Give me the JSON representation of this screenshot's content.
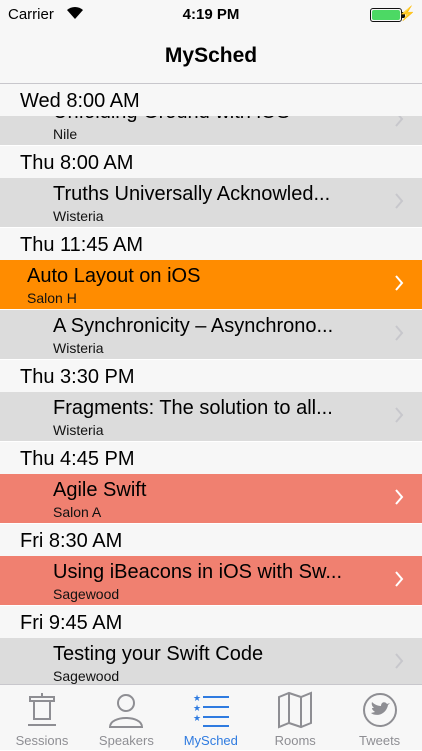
{
  "status_bar": {
    "carrier": "Carrier",
    "time": "4:19 PM"
  },
  "nav": {
    "title": "MySched"
  },
  "sections": [
    {
      "header": "Wed 8:00 AM",
      "rows": [
        {
          "title": "Unfolding Ground with iOS",
          "room": "Nile",
          "color": "gray",
          "indent": 1
        }
      ]
    },
    {
      "header": "Thu 8:00 AM",
      "rows": [
        {
          "title": "Truths Universally Acknowled...",
          "room": "Wisteria",
          "color": "gray",
          "indent": 1
        }
      ]
    },
    {
      "header": "Thu 11:45 AM",
      "rows": [
        {
          "title": "Auto Layout on iOS",
          "room": "Salon H",
          "color": "orange",
          "indent": 0
        },
        {
          "title": "A Synchronicity – Asynchrono...",
          "room": "Wisteria",
          "color": "gray",
          "indent": 1
        }
      ]
    },
    {
      "header": "Thu 3:30 PM",
      "rows": [
        {
          "title": "Fragments: The solution to all...",
          "room": "Wisteria",
          "color": "gray",
          "indent": 1
        }
      ]
    },
    {
      "header": "Thu 4:45 PM",
      "rows": [
        {
          "title": "Agile Swift",
          "room": "Salon A",
          "color": "salmon",
          "indent": 1
        }
      ]
    },
    {
      "header": "Fri 8:30 AM",
      "rows": [
        {
          "title": "Using iBeacons in iOS with Sw...",
          "room": "Sagewood",
          "color": "salmon",
          "indent": 1
        }
      ]
    },
    {
      "header": "Fri 9:45 AM",
      "rows": [
        {
          "title": "Testing your Swift Code",
          "room": "Sagewood",
          "color": "gray",
          "indent": 1
        }
      ]
    }
  ],
  "tabs": [
    {
      "label": "Sessions",
      "icon": "podium-icon",
      "active": false
    },
    {
      "label": "Speakers",
      "icon": "person-icon",
      "active": false
    },
    {
      "label": "MySched",
      "icon": "star-list-icon",
      "active": true
    },
    {
      "label": "Rooms",
      "icon": "map-icon",
      "active": false
    },
    {
      "label": "Tweets",
      "icon": "twitter-bird-icon",
      "active": false
    }
  ],
  "colors": {
    "gray": "#dcdcdc",
    "orange": "#ff8c00",
    "salmon": "#f08070",
    "tab_active": "#2f7be0",
    "tab_inactive": "#8e8e93"
  }
}
